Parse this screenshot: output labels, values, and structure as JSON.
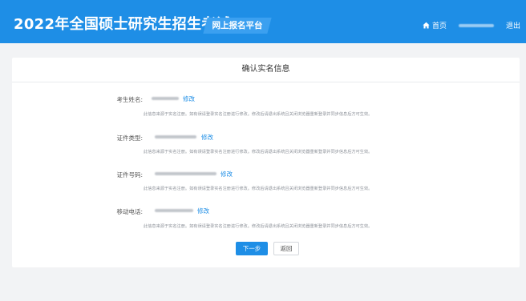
{
  "header": {
    "title": "2022年全国硕士研究生招生考试",
    "platform": "网上报名平台",
    "home_label": "首页",
    "logout_label": "退出"
  },
  "card": {
    "title": "确认实名信息"
  },
  "rows": [
    {
      "label": "考生姓名:",
      "edit": "修改",
      "note": "此信息来源于实名注册。如有误请登录实名注册进行修改。修改后请退出系统且关闭浏览器重新登录并同步信息后方可生效。"
    },
    {
      "label": "证件类型:",
      "edit": "修改",
      "note": "此信息来源于实名注册。如有误请登录实名注册进行修改。修改后请退出系统且关闭浏览器重新登录并同步信息后方可生效。"
    },
    {
      "label": "证件号码:",
      "edit": "修改",
      "note": "此信息来源于实名注册。如有误请登录实名注册进行修改。修改后请退出系统且关闭浏览器重新登录并同步信息后方可生效。"
    },
    {
      "label": "移动电话:",
      "edit": "修改",
      "note": "此信息来源于实名注册。如有误请登录实名注册进行修改。修改后请退出系统且关闭浏览器重新登录并同步信息后方可生效。"
    }
  ],
  "actions": {
    "next_label": "下一步",
    "back_label": "返回"
  },
  "colors": {
    "header_bg": "#1e8ee6",
    "link": "#1e8ee6",
    "page_bg": "#f2f3f5"
  }
}
